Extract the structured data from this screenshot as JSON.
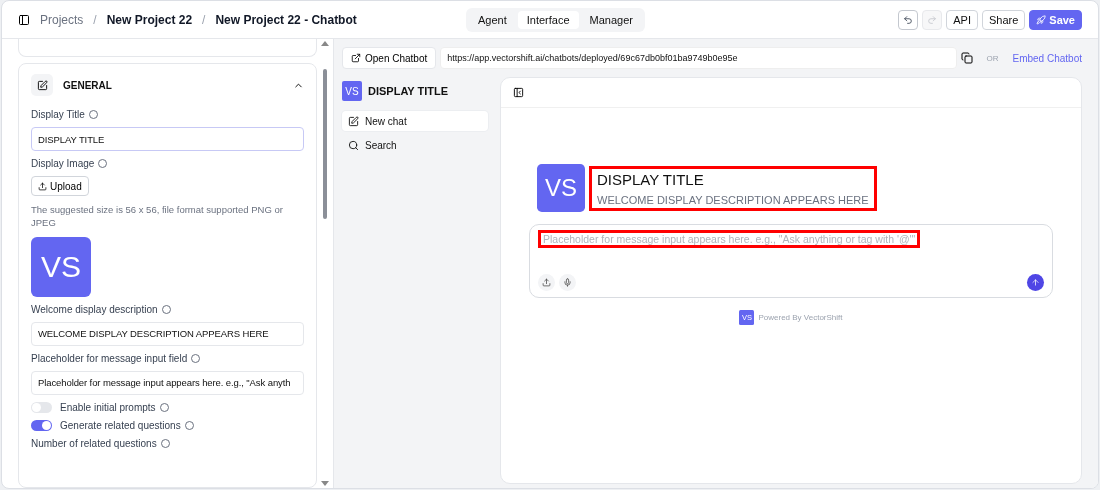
{
  "breadcrumb": [
    "Projects",
    "New Project 22",
    "New Project 22 - Chatbot"
  ],
  "breadcrumb_separators": [
    "/",
    "/"
  ],
  "mode_tabs": [
    {
      "label": "Agent",
      "selected": false
    },
    {
      "label": "Interface",
      "selected": true
    },
    {
      "label": "Manager",
      "selected": false
    }
  ],
  "history_buttons": [
    {
      "kind": "undo",
      "disabled": false
    },
    {
      "kind": "redo",
      "disabled": true
    }
  ],
  "actions": [
    {
      "label": "API",
      "kind": "plain"
    },
    {
      "label": "Share",
      "kind": "plain"
    },
    {
      "label": "Save",
      "kind": "primary"
    }
  ],
  "general": {
    "title": "GENERAL",
    "expanded": true,
    "display_title": {
      "label": "Display Title",
      "value": "DISPLAY TITLE"
    },
    "display_image": {
      "label": "Display Image",
      "button": "Upload",
      "hint": "The suggested size is 56 x 56, file format supported PNG or JPEG",
      "image_text": "VS"
    },
    "welcome": {
      "label": "Welcome display description",
      "value": "WELCOME DISPLAY DESCRIPTION APPEARS HERE"
    },
    "placeholder_field": {
      "label": "Placeholder for message input field",
      "value": "Placeholder for message input appears here. e.g., \"Ask anyth"
    },
    "toggles": [
      {
        "label": "Enable initial prompts",
        "on": false
      },
      {
        "label": "Generate related questions",
        "on": true
      }
    ],
    "related_count": {
      "label": "Number of related questions"
    }
  },
  "url_bar": {
    "open_button": "Open Chatbot",
    "url": "https://app.vectorshift.ai/chatbots/deployed/69c67db0bf01ba9749b0e95e",
    "or_text": "OR",
    "embed_link": "Embed Chatbot"
  },
  "preview": {
    "sidebar": {
      "logo_text": "VS",
      "title": "DISPLAY TITLE",
      "items": [
        {
          "kind": "new",
          "label": "New chat",
          "selected": true
        },
        {
          "kind": "search",
          "label": "Search",
          "selected": false
        }
      ]
    },
    "chat": {
      "logo_text": "VS",
      "title": "DISPLAY TITLE",
      "description": "WELCOME DISPLAY DESCRIPTION APPEARS HERE",
      "heading_highlighted": true,
      "input_placeholder": "Placeholder for message input appears here. e.g., \"Ask anything or tag with '@'\"",
      "placeholder_highlighted": true,
      "powered_logo": "VS",
      "powered_by": "Powered By VectorShift"
    }
  }
}
